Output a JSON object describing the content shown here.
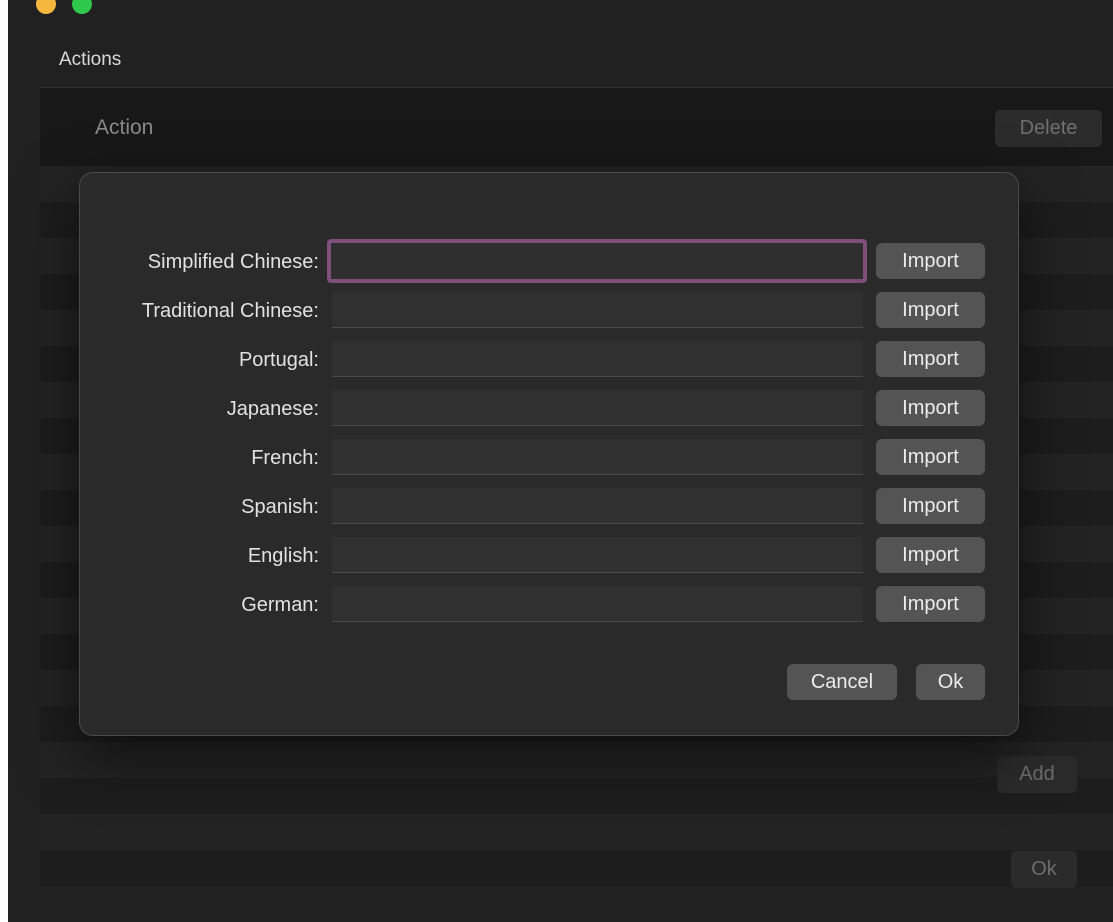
{
  "window": {
    "section_title": "Actions",
    "header_column": "Action",
    "delete_label": "Delete",
    "add_label": "Add",
    "ok_label": "Ok"
  },
  "dialog": {
    "rows": [
      {
        "label": "Simplified Chinese:",
        "value": "",
        "button": "Import"
      },
      {
        "label": "Traditional Chinese:",
        "value": "",
        "button": "Import"
      },
      {
        "label": "Portugal:",
        "value": "",
        "button": "Import"
      },
      {
        "label": "Japanese:",
        "value": "",
        "button": "Import"
      },
      {
        "label": "French:",
        "value": "",
        "button": "Import"
      },
      {
        "label": "Spanish:",
        "value": "",
        "button": "Import"
      },
      {
        "label": "English:",
        "value": "",
        "button": "Import"
      },
      {
        "label": "German:",
        "value": "",
        "button": "Import"
      }
    ],
    "cancel_label": "Cancel",
    "ok_label": "Ok"
  },
  "colors": {
    "focus_ring": "#7e4f7a",
    "button_bg": "#545454",
    "dialog_bg": "#2a2a2a"
  }
}
